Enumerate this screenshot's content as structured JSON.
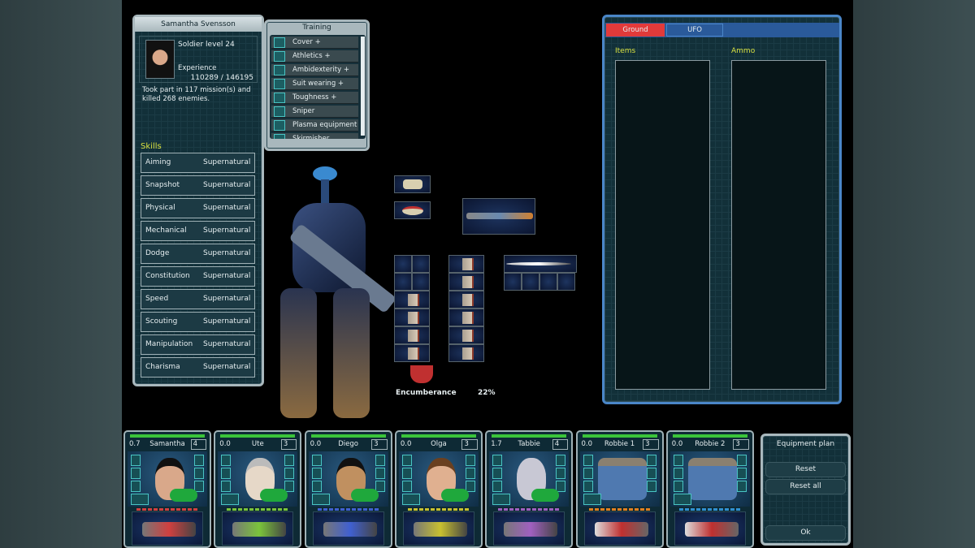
{
  "soldier": {
    "name": "Samantha Svensson",
    "level": "Soldier level 24",
    "experience_label": "Experience",
    "experience": "110289 / 146195",
    "history": "Took part in 117 mission(s) and killed 268 enemies."
  },
  "skills_title": "Skills",
  "skills": [
    {
      "name": "Aiming",
      "value": "Supernatural"
    },
    {
      "name": "Snapshot",
      "value": "Supernatural"
    },
    {
      "name": "Physical",
      "value": "Supernatural"
    },
    {
      "name": "Mechanical",
      "value": "Supernatural"
    },
    {
      "name": "Dodge",
      "value": "Supernatural"
    },
    {
      "name": "Constitution",
      "value": "Supernatural"
    },
    {
      "name": "Speed",
      "value": "Supernatural"
    },
    {
      "name": "Scouting",
      "value": "Supernatural"
    },
    {
      "name": "Manipulation",
      "value": "Supernatural"
    },
    {
      "name": "Charisma",
      "value": "Supernatural"
    }
  ],
  "training": {
    "title": "Training",
    "items": [
      "Cover +",
      "Athletics +",
      "Ambidexterity +",
      "Suit wearing +",
      "Toughness +",
      "Sniper",
      "Plasma equipment",
      "Skirmisher"
    ]
  },
  "encumbrance": {
    "label": "Encumberance",
    "value": "22%"
  },
  "storage": {
    "tabs": [
      {
        "label": "Ground",
        "active": true
      },
      {
        "label": "UFO",
        "active": false
      }
    ],
    "items_label": "Items",
    "ammo_label": "Ammo"
  },
  "squad": [
    {
      "tu": "0.7",
      "name": "Samantha",
      "rank": "4",
      "stripe": "#d04040",
      "skin": "#d9a88a",
      "hair": "#111"
    },
    {
      "tu": "0.0",
      "name": "Ute",
      "rank": "3",
      "stripe": "#7bc43b",
      "skin": "#e6d8c8",
      "hair": "#bbb"
    },
    {
      "tu": "0.0",
      "name": "Diego",
      "rank": "3",
      "stripe": "#4060d0",
      "skin": "#c09060",
      "hair": "#111"
    },
    {
      "tu": "0.0",
      "name": "Olga",
      "rank": "3",
      "stripe": "#c8c030",
      "skin": "#e0b090",
      "hair": "#6a4020"
    },
    {
      "tu": "1.7",
      "name": "Tabbie",
      "rank": "4",
      "stripe": "#a060c0",
      "skin": "#c8c8d4",
      "hair": "#c8c8d4"
    },
    {
      "tu": "0.0",
      "name": "Robbie 1",
      "rank": "3",
      "stripe": "#e08020",
      "skin": "#4f79b0",
      "hair": "#8a8070"
    },
    {
      "tu": "0.0",
      "name": "Robbie 2",
      "rank": "3",
      "stripe": "#3090d0",
      "skin": "#4f79b0",
      "hair": "#8a8070"
    }
  ],
  "equipment_plan": {
    "title": "Equipment plan",
    "reset": "Reset",
    "reset_all": "Reset all",
    "ok": "Ok"
  },
  "colors": {
    "active_tab": "#e23a3a",
    "tab": "#2a5a9a",
    "label_yellow": "#d8e040",
    "frame": "#a9b8bd"
  }
}
